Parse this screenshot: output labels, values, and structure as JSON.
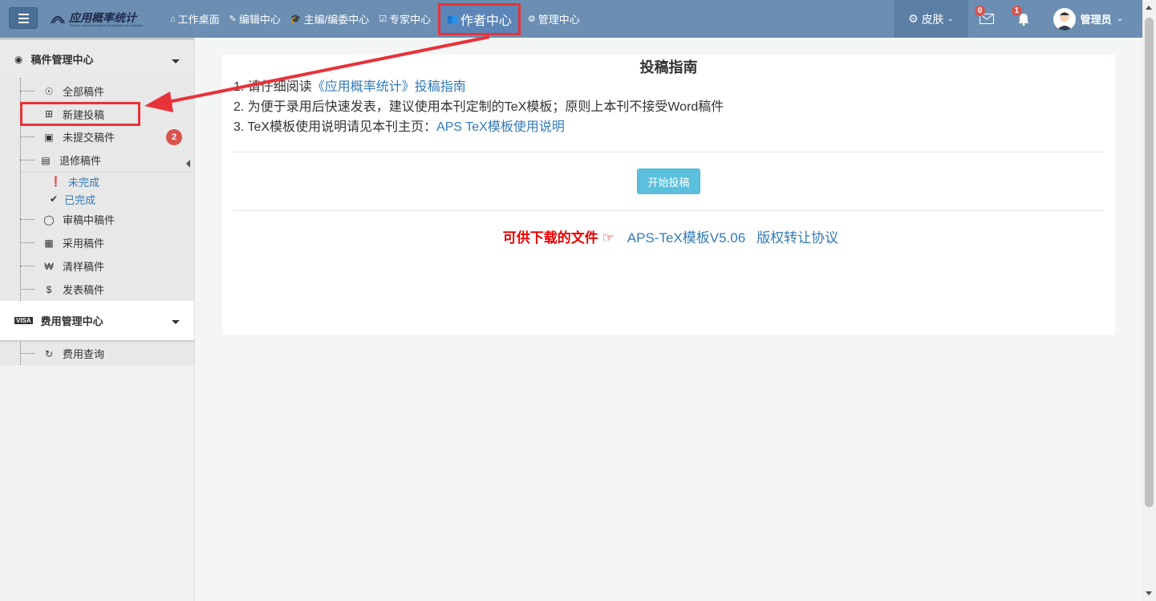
{
  "navbar": {
    "logo_title": "应用概率统计",
    "logo_subtitle": "Chinese Journal of Applied Probability and Statistics",
    "items": [
      {
        "icon": "home-icon",
        "label": "工作桌面"
      },
      {
        "icon": "edit-icon",
        "label": "编辑中心"
      },
      {
        "icon": "graduation-cap-icon",
        "label": "主编/编委中心"
      },
      {
        "icon": "check-square-icon",
        "label": "专家中心"
      },
      {
        "icon": "users-icon",
        "label": "作者中心"
      },
      {
        "icon": "gear-icon",
        "label": "管理中心"
      }
    ],
    "skin_label": "皮肤",
    "mail_count": "0",
    "bell_count": "1",
    "user_name": "管理员"
  },
  "sidebar": {
    "manuscript_group": "稿件管理中心",
    "items": [
      {
        "icon": "life-ring-icon",
        "label": "全部稿件"
      },
      {
        "icon": "plus-square-icon",
        "label": "新建投稿"
      },
      {
        "icon": "briefcase-icon",
        "label": "未提交稿件",
        "badge": "2"
      },
      {
        "icon": "book-icon",
        "label": "退修稿件"
      }
    ],
    "revision_sub": [
      {
        "icon": "exclamation-circle-icon",
        "label": "未完成"
      },
      {
        "icon": "check-circle-icon",
        "label": "已完成"
      }
    ],
    "items2": [
      {
        "icon": "comment-icon",
        "label": "审稿中稿件"
      },
      {
        "icon": "map-icon",
        "label": "采用稿件"
      },
      {
        "icon": "won-icon",
        "label": "清样稿件"
      },
      {
        "icon": "dollar-icon",
        "label": "发表稿件"
      }
    ],
    "fee_group": "费用管理中心",
    "fee_items": [
      {
        "icon": "refresh-icon",
        "label": "费用查询"
      }
    ]
  },
  "main": {
    "title": "投稿指南",
    "line1_prefix": "1. 请仔细阅读",
    "line1_link": "《应用概率统计》投稿指南",
    "line2": "2. 为便于录用后快速发表，建议使用本刊定制的TeX模板；原则上本刊不接受Word稿件",
    "line3_prefix": "3. TeX模板使用说明请见本刊主页：",
    "line3_link": "APS TeX模板使用说明",
    "start_button": "开始投稿",
    "downloads_label": "可供下载的文件",
    "download_links": [
      "APS-TeX模板V5.06",
      "版权转让协议"
    ]
  },
  "colors": {
    "navbar": "#6b8eb2",
    "highlight": "#e8323a",
    "link": "#337ab7",
    "button": "#5bc0de"
  }
}
